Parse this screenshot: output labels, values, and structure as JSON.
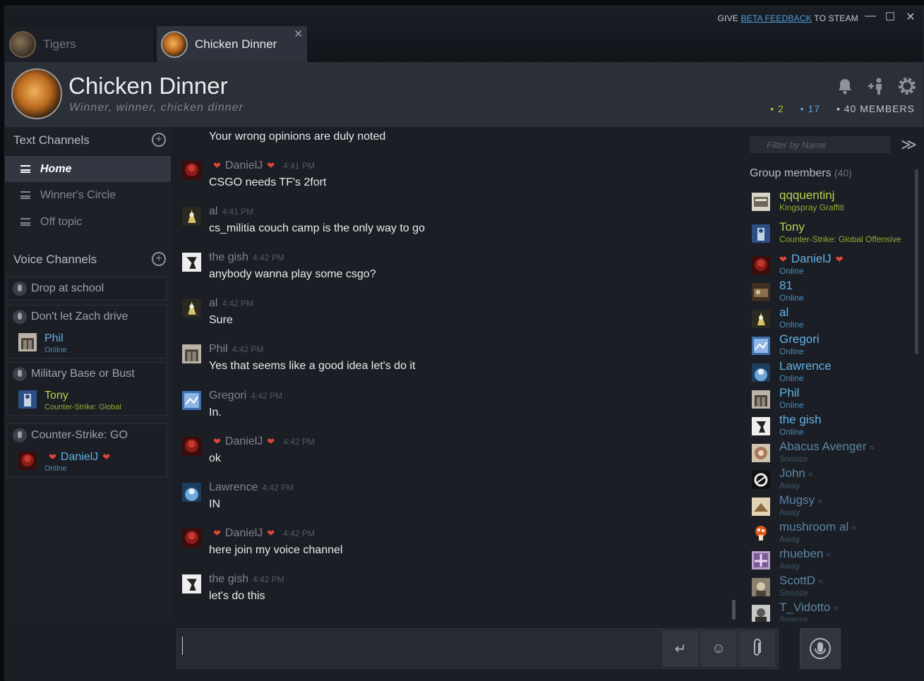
{
  "titlebar": {
    "beta_prefix": "GIVE",
    "beta_link": "BETA FEEDBACK",
    "beta_suffix": "TO STEAM",
    "minimize": "—",
    "maximize": "☐",
    "close": "✕"
  },
  "tabs": [
    {
      "label": "Tigers"
    },
    {
      "label": "Chicken Dinner",
      "close": "✕"
    }
  ],
  "group": {
    "name": "Chicken Dinner",
    "tagline": "Winner, winner, chicken dinner",
    "count_ingame": "• 2",
    "count_online": "• 17",
    "count_members": "• 40 MEMBERS"
  },
  "sidebar": {
    "text_channels_label": "Text Channels",
    "voice_channels_label": "Voice Channels",
    "plus": "+",
    "text_channels": [
      "Home",
      "Winner's Circle",
      "Off topic"
    ],
    "voice_channels": [
      {
        "name": "Drop at school",
        "users": []
      },
      {
        "name": "Don't let Zach drive",
        "users": [
          {
            "name": "Phil",
            "status": "Online"
          }
        ]
      },
      {
        "name": "Military Base or Bust",
        "users": [
          {
            "name": "Tony",
            "status": "Counter-Strike: Global"
          }
        ]
      },
      {
        "name": "Counter-Strike: GO",
        "users": [
          {
            "name": "DanielJ",
            "status": "Online"
          }
        ]
      }
    ]
  },
  "chat": {
    "messages": [
      {
        "author": "",
        "time": "",
        "text": "Your wrong opinions are duly noted"
      },
      {
        "author": "DanielJ",
        "time": "4:41 PM",
        "text": "CSGO needs TF's 2fort"
      },
      {
        "author": "al",
        "time": "4:41 PM",
        "text": "cs_militia couch camp is the only way to go"
      },
      {
        "author": "the gish",
        "time": "4:42 PM",
        "text": "anybody wanna play some csgo?"
      },
      {
        "author": "al",
        "time": "4:42 PM",
        "text": "Sure"
      },
      {
        "author": "Phil",
        "time": "4:42 PM",
        "text": "Yes that seems like a good idea let's do it"
      },
      {
        "author": "Gregori",
        "time": "4:42 PM",
        "text": "In."
      },
      {
        "author": "DanielJ",
        "time": "4:42 PM",
        "text": "ok"
      },
      {
        "author": "Lawrence",
        "time": "4:42 PM",
        "text": "IN"
      },
      {
        "author": "DanielJ",
        "time": "4:42 PM",
        "text": "here join my voice channel"
      },
      {
        "author": "the gish",
        "time": "4:42 PM",
        "text": "let's do this"
      }
    ]
  },
  "members": {
    "filter_placeholder": "Filter by Name",
    "collapse": "≫",
    "heading": "Group members",
    "count": "(40)",
    "list": [
      {
        "name": "qqquentinj",
        "status": "Kingspray Graffiti",
        "state": "ingame"
      },
      {
        "name": "Tony",
        "status": "Counter-Strike: Global Offensive",
        "state": "ingame"
      },
      {
        "name": "DanielJ",
        "status": "Online",
        "state": "online"
      },
      {
        "name": "81",
        "status": "Online",
        "state": "online"
      },
      {
        "name": "al",
        "status": "Online",
        "state": "online"
      },
      {
        "name": "Gregori",
        "status": "Online",
        "state": "online"
      },
      {
        "name": "Lawrence",
        "status": "Online",
        "state": "online"
      },
      {
        "name": "Phil",
        "status": "Online",
        "state": "online"
      },
      {
        "name": "the gish",
        "status": "Online",
        "state": "online"
      },
      {
        "name": "Abacus Avenger",
        "status": "Snooze",
        "state": "away"
      },
      {
        "name": "John",
        "status": "Away",
        "state": "away"
      },
      {
        "name": "Mugsy",
        "status": "Away",
        "state": "away"
      },
      {
        "name": "mushroom al",
        "status": "Away",
        "state": "away"
      },
      {
        "name": "rhueben",
        "status": "Away",
        "state": "away"
      },
      {
        "name": "ScottD",
        "status": "Snooze",
        "state": "away"
      },
      {
        "name": "T_Vidotto",
        "status": "Snooze",
        "state": "away"
      }
    ]
  },
  "input": {
    "enter": "↵",
    "emoji": "☺"
  },
  "colors": {
    "ingame": "#b5d34b",
    "online": "#63b2e8",
    "away": "#5a86a8",
    "heart": "#e0463a"
  }
}
